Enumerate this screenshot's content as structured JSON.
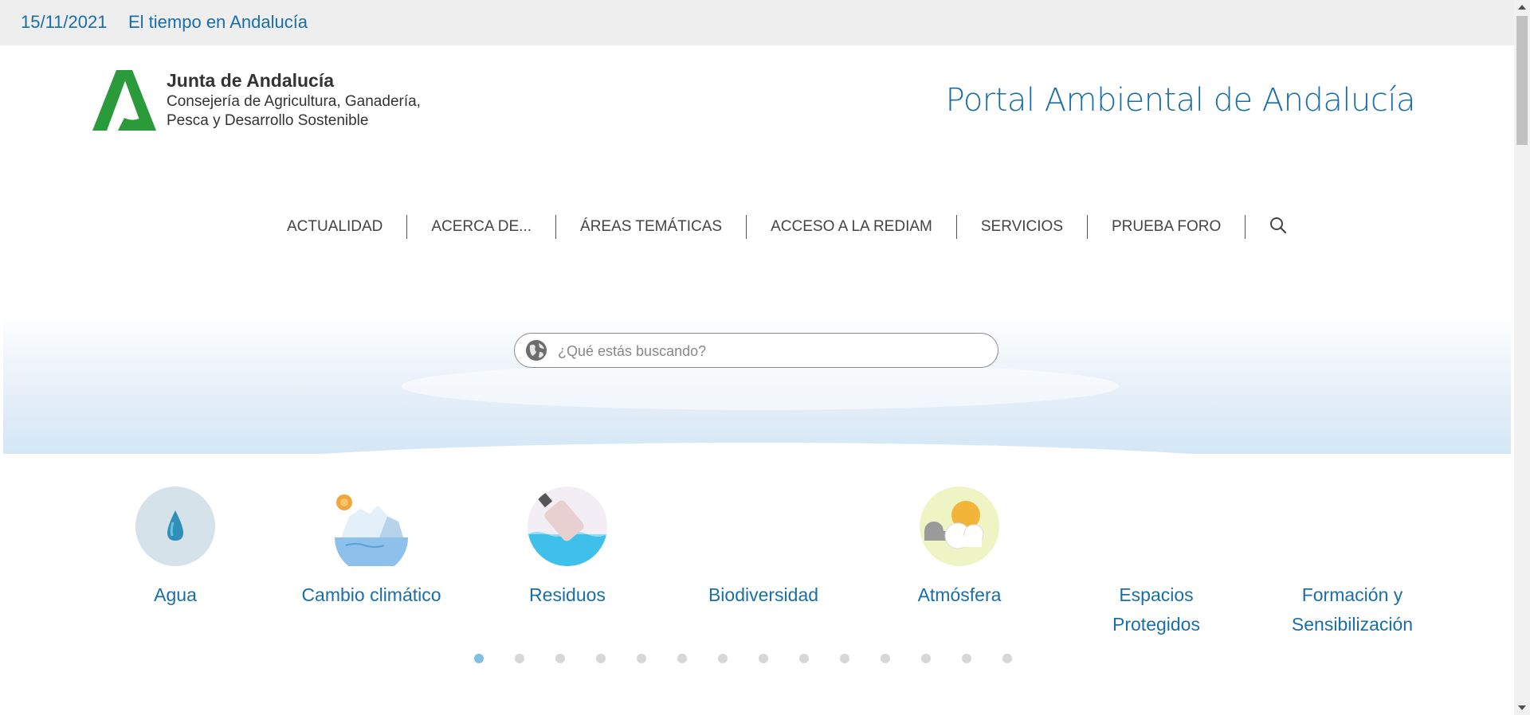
{
  "topbar": {
    "date": "15/11/2021",
    "weather_link": "El tiempo en Andalucía"
  },
  "logo": {
    "title": "Junta de Andalucía",
    "subtitle": "Consejería de Agricultura, Ganadería, Pesca y Desarrollo Sostenible",
    "color": "#2b9a3b"
  },
  "portal_title": "Portal Ambiental de Andalucía",
  "nav": {
    "items": [
      "ACTUALIDAD",
      "ACERCA DE...",
      "ÁREAS TEMÁTICAS",
      "ACCESO A LA REDIAM",
      "SERVICIOS",
      "PRUEBA FORO"
    ],
    "search_icon": "search-icon"
  },
  "search": {
    "placeholder": "¿Qué estás buscando?",
    "icon": "globe-icon"
  },
  "categories": [
    {
      "label": "Agua",
      "icon": "water-drop-icon"
    },
    {
      "label": "Cambio climático",
      "icon": "iceberg-icon"
    },
    {
      "label": "Residuos",
      "icon": "bottle-waste-icon"
    },
    {
      "label": "Biodiversidad",
      "icon": "biodiversity-icon"
    },
    {
      "label": "Atmósfera",
      "icon": "weather-sun-cloud-icon"
    },
    {
      "label": "Espacios Protegidos",
      "icon": "protected-spaces-icon"
    },
    {
      "label": "Formación y Sensibilización",
      "icon": "training-icon"
    }
  ],
  "carousel": {
    "total": 14,
    "active": 1
  },
  "colors": {
    "accent": "#1a6ea8",
    "topbar_bg": "#eeeeee",
    "dot_active": "#7fc0e2",
    "dot": "#d7d7d7"
  }
}
